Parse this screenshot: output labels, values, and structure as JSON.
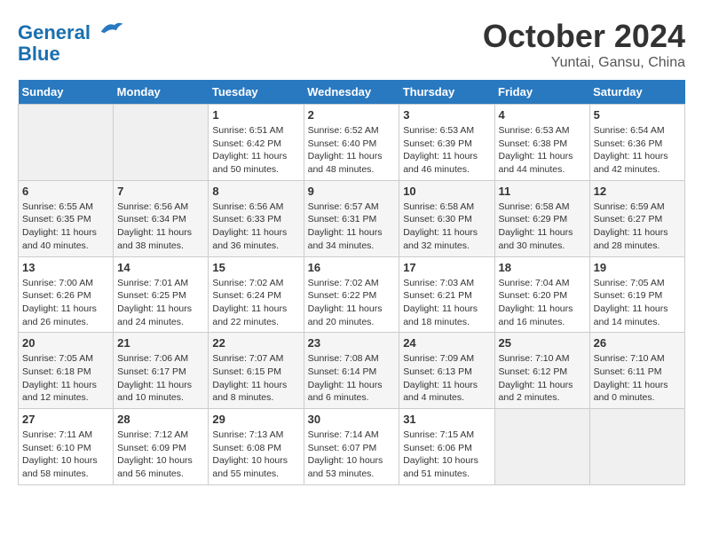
{
  "header": {
    "logo_line1": "General",
    "logo_line2": "Blue",
    "month": "October 2024",
    "location": "Yuntai, Gansu, China"
  },
  "weekdays": [
    "Sunday",
    "Monday",
    "Tuesday",
    "Wednesday",
    "Thursday",
    "Friday",
    "Saturday"
  ],
  "weeks": [
    [
      {
        "day": "",
        "info": ""
      },
      {
        "day": "",
        "info": ""
      },
      {
        "day": "1",
        "info": "Sunrise: 6:51 AM\nSunset: 6:42 PM\nDaylight: 11 hours and 50 minutes."
      },
      {
        "day": "2",
        "info": "Sunrise: 6:52 AM\nSunset: 6:40 PM\nDaylight: 11 hours and 48 minutes."
      },
      {
        "day": "3",
        "info": "Sunrise: 6:53 AM\nSunset: 6:39 PM\nDaylight: 11 hours and 46 minutes."
      },
      {
        "day": "4",
        "info": "Sunrise: 6:53 AM\nSunset: 6:38 PM\nDaylight: 11 hours and 44 minutes."
      },
      {
        "day": "5",
        "info": "Sunrise: 6:54 AM\nSunset: 6:36 PM\nDaylight: 11 hours and 42 minutes."
      }
    ],
    [
      {
        "day": "6",
        "info": "Sunrise: 6:55 AM\nSunset: 6:35 PM\nDaylight: 11 hours and 40 minutes."
      },
      {
        "day": "7",
        "info": "Sunrise: 6:56 AM\nSunset: 6:34 PM\nDaylight: 11 hours and 38 minutes."
      },
      {
        "day": "8",
        "info": "Sunrise: 6:56 AM\nSunset: 6:33 PM\nDaylight: 11 hours and 36 minutes."
      },
      {
        "day": "9",
        "info": "Sunrise: 6:57 AM\nSunset: 6:31 PM\nDaylight: 11 hours and 34 minutes."
      },
      {
        "day": "10",
        "info": "Sunrise: 6:58 AM\nSunset: 6:30 PM\nDaylight: 11 hours and 32 minutes."
      },
      {
        "day": "11",
        "info": "Sunrise: 6:58 AM\nSunset: 6:29 PM\nDaylight: 11 hours and 30 minutes."
      },
      {
        "day": "12",
        "info": "Sunrise: 6:59 AM\nSunset: 6:27 PM\nDaylight: 11 hours and 28 minutes."
      }
    ],
    [
      {
        "day": "13",
        "info": "Sunrise: 7:00 AM\nSunset: 6:26 PM\nDaylight: 11 hours and 26 minutes."
      },
      {
        "day": "14",
        "info": "Sunrise: 7:01 AM\nSunset: 6:25 PM\nDaylight: 11 hours and 24 minutes."
      },
      {
        "day": "15",
        "info": "Sunrise: 7:02 AM\nSunset: 6:24 PM\nDaylight: 11 hours and 22 minutes."
      },
      {
        "day": "16",
        "info": "Sunrise: 7:02 AM\nSunset: 6:22 PM\nDaylight: 11 hours and 20 minutes."
      },
      {
        "day": "17",
        "info": "Sunrise: 7:03 AM\nSunset: 6:21 PM\nDaylight: 11 hours and 18 minutes."
      },
      {
        "day": "18",
        "info": "Sunrise: 7:04 AM\nSunset: 6:20 PM\nDaylight: 11 hours and 16 minutes."
      },
      {
        "day": "19",
        "info": "Sunrise: 7:05 AM\nSunset: 6:19 PM\nDaylight: 11 hours and 14 minutes."
      }
    ],
    [
      {
        "day": "20",
        "info": "Sunrise: 7:05 AM\nSunset: 6:18 PM\nDaylight: 11 hours and 12 minutes."
      },
      {
        "day": "21",
        "info": "Sunrise: 7:06 AM\nSunset: 6:17 PM\nDaylight: 11 hours and 10 minutes."
      },
      {
        "day": "22",
        "info": "Sunrise: 7:07 AM\nSunset: 6:15 PM\nDaylight: 11 hours and 8 minutes."
      },
      {
        "day": "23",
        "info": "Sunrise: 7:08 AM\nSunset: 6:14 PM\nDaylight: 11 hours and 6 minutes."
      },
      {
        "day": "24",
        "info": "Sunrise: 7:09 AM\nSunset: 6:13 PM\nDaylight: 11 hours and 4 minutes."
      },
      {
        "day": "25",
        "info": "Sunrise: 7:10 AM\nSunset: 6:12 PM\nDaylight: 11 hours and 2 minutes."
      },
      {
        "day": "26",
        "info": "Sunrise: 7:10 AM\nSunset: 6:11 PM\nDaylight: 11 hours and 0 minutes."
      }
    ],
    [
      {
        "day": "27",
        "info": "Sunrise: 7:11 AM\nSunset: 6:10 PM\nDaylight: 10 hours and 58 minutes."
      },
      {
        "day": "28",
        "info": "Sunrise: 7:12 AM\nSunset: 6:09 PM\nDaylight: 10 hours and 56 minutes."
      },
      {
        "day": "29",
        "info": "Sunrise: 7:13 AM\nSunset: 6:08 PM\nDaylight: 10 hours and 55 minutes."
      },
      {
        "day": "30",
        "info": "Sunrise: 7:14 AM\nSunset: 6:07 PM\nDaylight: 10 hours and 53 minutes."
      },
      {
        "day": "31",
        "info": "Sunrise: 7:15 AM\nSunset: 6:06 PM\nDaylight: 10 hours and 51 minutes."
      },
      {
        "day": "",
        "info": ""
      },
      {
        "day": "",
        "info": ""
      }
    ]
  ]
}
